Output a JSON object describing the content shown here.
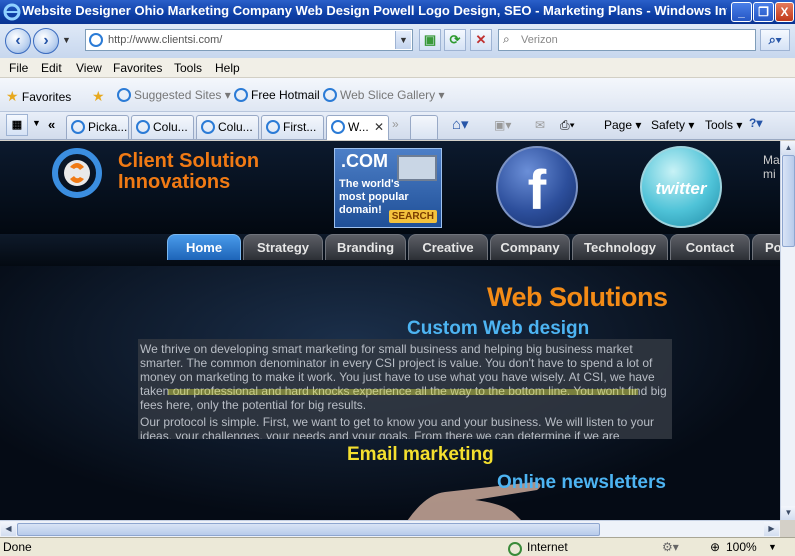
{
  "window": {
    "title": "Website Designer Ohio Marketing Company Web Design Powell Logo Design, SEO - Marketing Plans - Windows Int...",
    "minimize": "_",
    "restore": "❐",
    "close": "X"
  },
  "address_bar": {
    "url": "http://www.clientsi.com/",
    "search_placeholder": "Verizon"
  },
  "menu": [
    "File",
    "Edit",
    "View",
    "Favorites",
    "Tools",
    "Help"
  ],
  "favorites_bar": {
    "favorites_label": "Favorites",
    "items": [
      "Suggested Sites ▾",
      "Free Hotmail",
      "Web Slice Gallery ▾"
    ]
  },
  "tabs": [
    {
      "label": "Picka..."
    },
    {
      "label": "Colu..."
    },
    {
      "label": "Colu..."
    },
    {
      "label": "First..."
    },
    {
      "label": "W..."
    }
  ],
  "command_bar": {
    "page": "Page ▾",
    "safety": "Safety ▾",
    "tools": "Tools ▾"
  },
  "site": {
    "brand_line1": "Client Solution",
    "brand_line2": "Innovations",
    "ad": {
      "dotcom": ".COM",
      "line1": "The world's",
      "line2": "most popular",
      "line3": "domain!",
      "search": "SEARCH"
    },
    "facebook_letter": "f",
    "twitter_label": "twitter",
    "trunc_text_1": "Ma",
    "trunc_text_2": "mi",
    "nav": [
      "Home",
      "Strategy",
      "Branding",
      "Creative",
      "Company",
      "Technology",
      "Contact",
      "Po"
    ],
    "active_nav": "Home",
    "headline": "Web Solutions",
    "custom_web_design": "Custom Web design",
    "body_text_1": "We thrive on developing smart marketing for small business and helping big business market smarter.  The common denominator in every CSI project is value.  You don't have to spend a lot of money on marketing to make it work.  You just have to use what you have wisely.   At CSI, we have taken our professional and hard knocks experience all the way to the bottom line.  You won't find big fees here, only the potential for big results.",
    "body_text_2": "Our protocol is simple.  First, we want to get to know you and your business.  We will listen to your ideas, your challenges, your needs and your goals.  From there we can determine if we are",
    "email_marketing": "Email marketing",
    "online_newsletters": "Online newsletters"
  },
  "status_bar": {
    "left": "Done",
    "zone": "Internet",
    "zoom": "100%"
  },
  "colors": {
    "titlebar": "#0d3fa6",
    "brand_orange": "#f07a14",
    "nav_active": "#1d64b8",
    "headline_orange": "#f38b16",
    "link_blue": "#4db4f2",
    "email_yellow": "#f4df2e"
  }
}
